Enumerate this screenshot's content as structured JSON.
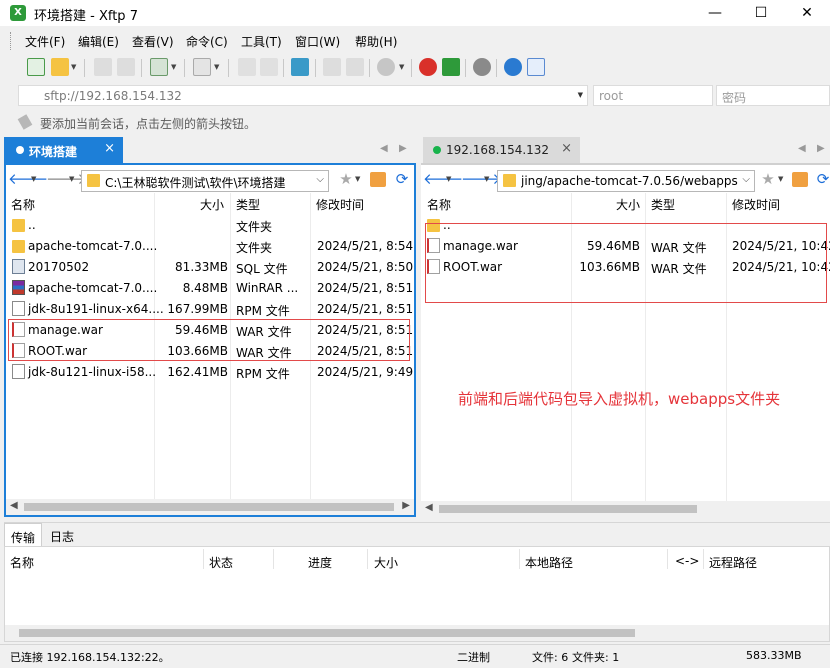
{
  "window": {
    "title": "环境搭建 - Xftp 7",
    "minimize": "—",
    "maximize": "☐",
    "close": "✕"
  },
  "menu": [
    "文件(F)",
    "编辑(E)",
    "查看(V)",
    "命令(C)",
    "工具(T)",
    "窗口(W)",
    "帮助(H)"
  ],
  "address": {
    "url": "sftp://192.168.154.132",
    "user_placeholder": "root",
    "password_placeholder": "密码"
  },
  "hint": "要添加当前会话，点击左侧的箭头按钮。",
  "tabs": {
    "local": "环境搭建",
    "remote": "192.168.154.132"
  },
  "columns": {
    "name": "名称",
    "size": "大小",
    "type": "类型",
    "modified": "修改时间"
  },
  "local": {
    "path": "C:\\王林聪软件测试\\软件\\环境搭建",
    "files": [
      {
        "name": "..",
        "size": "",
        "type": "文件夹",
        "modified": "",
        "icon": "folder"
      },
      {
        "name": "apache-tomcat-7.0....",
        "size": "",
        "type": "文件夹",
        "modified": "2024/5/21, 8:54",
        "icon": "folder"
      },
      {
        "name": "20170502",
        "size": "81.33MB",
        "type": "SQL 文件",
        "modified": "2024/5/21, 8:50",
        "icon": "sql"
      },
      {
        "name": "apache-tomcat-7.0....",
        "size": "8.48MB",
        "type": "WinRAR ...",
        "modified": "2024/5/21, 8:51",
        "icon": "rar"
      },
      {
        "name": "jdk-8u191-linux-x64....",
        "size": "167.99MB",
        "type": "RPM 文件",
        "modified": "2024/5/21, 8:51",
        "icon": "file"
      },
      {
        "name": "manage.war",
        "size": "59.46MB",
        "type": "WAR 文件",
        "modified": "2024/5/21, 8:51",
        "icon": "war"
      },
      {
        "name": "ROOT.war",
        "size": "103.66MB",
        "type": "WAR 文件",
        "modified": "2024/5/21, 8:51",
        "icon": "war"
      },
      {
        "name": "jdk-8u121-linux-i58...",
        "size": "162.41MB",
        "type": "RPM 文件",
        "modified": "2024/5/21, 9:49",
        "icon": "file"
      }
    ]
  },
  "remote": {
    "path": "jing/apache-tomcat-7.0.56/webapps",
    "files": [
      {
        "name": "..",
        "size": "",
        "type": "",
        "modified": "",
        "icon": "folder"
      },
      {
        "name": "manage.war",
        "size": "59.46MB",
        "type": "WAR 文件",
        "modified": "2024/5/21, 10:42",
        "icon": "war"
      },
      {
        "name": "ROOT.war",
        "size": "103.66MB",
        "type": "WAR 文件",
        "modified": "2024/5/21, 10:42",
        "icon": "war"
      }
    ]
  },
  "annotation": "前端和后端代码包导入虚拟机，webapps文件夹",
  "bottom_tabs": [
    "传输",
    "日志"
  ],
  "transfer_columns": [
    "名称",
    "状态",
    "进度",
    "大小",
    "本地路径",
    "<->",
    "远程路径"
  ],
  "status": {
    "connection": "已连接 192.168.154.132:22。",
    "mode": "二进制",
    "files": "文件: 6",
    "folders": "文件夹: 1",
    "total": "583.33MB"
  }
}
